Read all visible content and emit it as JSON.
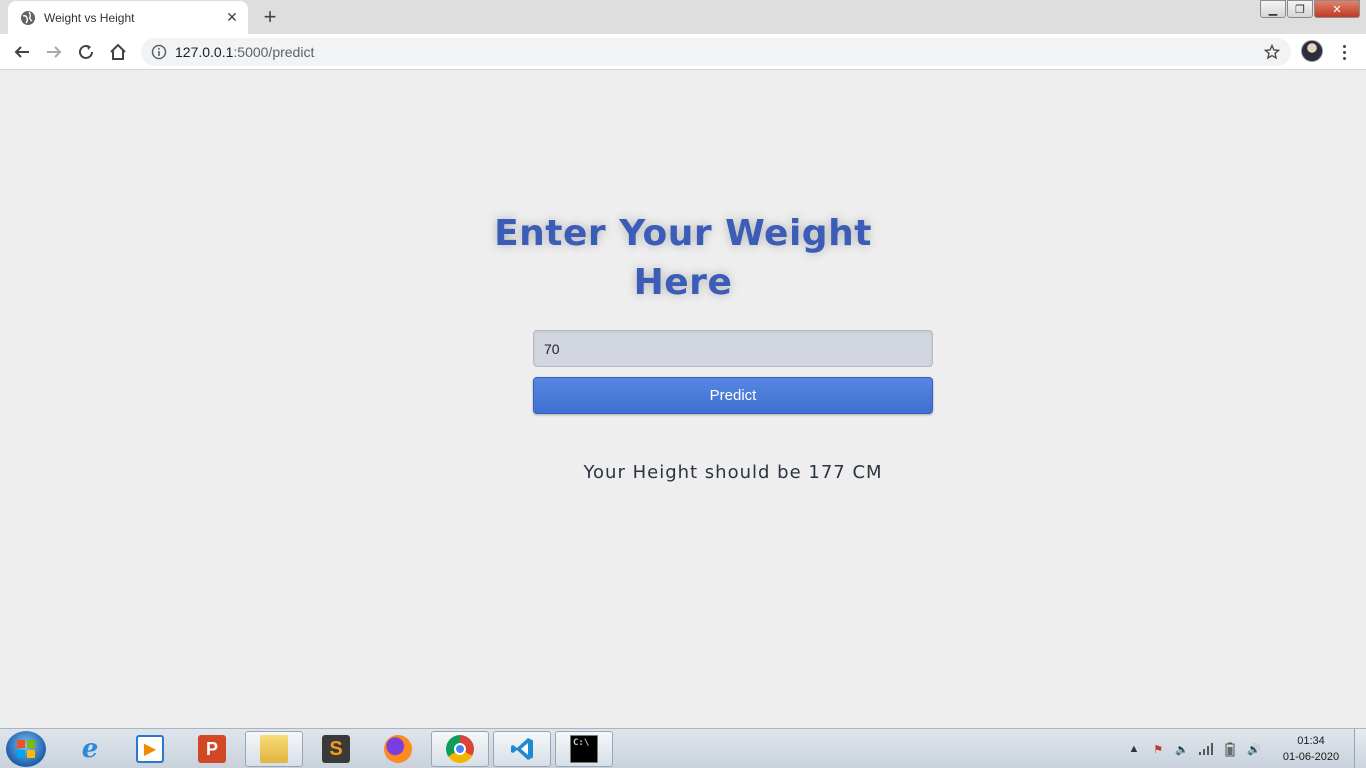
{
  "browser": {
    "tab_title": "Weight vs Height",
    "url_host": "127.0.0.1",
    "url_rest": ":5000/predict"
  },
  "page": {
    "heading": "Enter Your Weight Here",
    "weight_value": "70",
    "predict_label": "Predict",
    "result_text": "Your Height should be 177 CM"
  },
  "taskbar": {
    "apps": [
      {
        "name": "internet-explorer",
        "icon": "ie-icon"
      },
      {
        "name": "media-player",
        "icon": "media-player-icon"
      },
      {
        "name": "powerpoint",
        "icon": "powerpoint-icon"
      },
      {
        "name": "file-explorer",
        "icon": "folder-icon"
      },
      {
        "name": "sublime-text",
        "icon": "sublime-icon"
      },
      {
        "name": "firefox",
        "icon": "firefox-icon"
      },
      {
        "name": "chrome",
        "icon": "chrome-icon"
      },
      {
        "name": "vscode",
        "icon": "vscode-icon"
      },
      {
        "name": "command-prompt",
        "icon": "cmd-icon"
      }
    ],
    "clock_time": "01:34",
    "clock_date": "01-06-2020"
  },
  "colors": {
    "heading": "#3b5db7",
    "button": "#4a7bdc",
    "input_bg": "#d2d6e0",
    "page_bg": "#eeeeee"
  }
}
